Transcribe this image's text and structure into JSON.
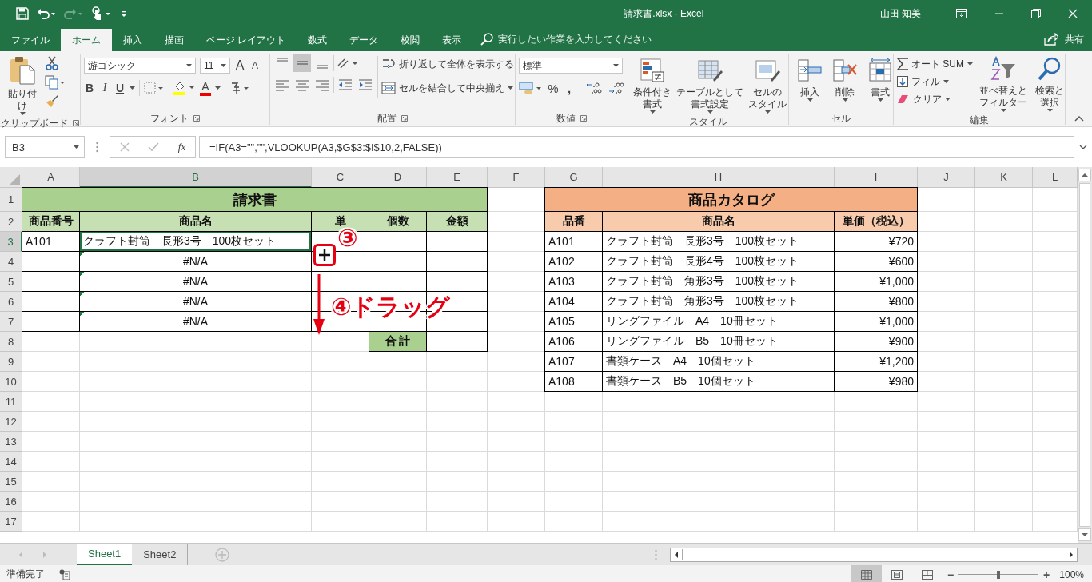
{
  "title_bar": {
    "title": "請求書.xlsx  -  Excel",
    "user": "山田 知美"
  },
  "tabs": [
    {
      "label": "ファイル",
      "selected": false
    },
    {
      "label": "ホーム",
      "selected": true
    },
    {
      "label": "挿入",
      "selected": false
    },
    {
      "label": "描画",
      "selected": false
    },
    {
      "label": "ページ レイアウト",
      "selected": false
    },
    {
      "label": "数式",
      "selected": false
    },
    {
      "label": "データ",
      "selected": false
    },
    {
      "label": "校閲",
      "selected": false
    },
    {
      "label": "表示",
      "selected": false
    }
  ],
  "tell_me": {
    "placeholder": "実行したい作業を入力してください"
  },
  "share": "共有",
  "ribbon": {
    "clipboard": {
      "paste": "貼り付け",
      "label": "クリップボード"
    },
    "font": {
      "name": "游ゴシック",
      "size": "11",
      "grow": "A",
      "shrink": "A",
      "bold": "B",
      "italic": "I",
      "underline": "U",
      "font_color": "A",
      "label": "フォント"
    },
    "alignment": {
      "wrap": "折り返して全体を表示する",
      "merge": "セルを結合して中央揃え",
      "label": "配置"
    },
    "number": {
      "format": "標準",
      "percent": "%",
      "comma": ",",
      "label": "数値"
    },
    "styles": {
      "buttons": [
        {
          "lines": [
            "条件付き",
            "書式"
          ]
        },
        {
          "lines": [
            "テーブルとして",
            "書式設定"
          ]
        },
        {
          "lines": [
            "セルの",
            "スタイル"
          ]
        }
      ],
      "label": "スタイル"
    },
    "cells": {
      "buttons": [
        {
          "lines": [
            "挿入"
          ]
        },
        {
          "lines": [
            "削除"
          ]
        },
        {
          "lines": [
            "書式"
          ]
        }
      ],
      "label": "セル"
    },
    "editing": {
      "autosum": "オート SUM",
      "fill": "フィル",
      "clear": "クリア",
      "sort": [
        "並べ替えと",
        "フィルター"
      ],
      "find": [
        "検索と",
        "選択"
      ],
      "label": "編集"
    }
  },
  "formula_bar": {
    "name_box": "B3",
    "fx": "fx",
    "formula": "=IF(A3=\"\",\"\",VLOOKUP(A3,$G$3:$I$10,2,FALSE))"
  },
  "sheet": {
    "columns": [
      {
        "label": "A",
        "selected": false
      },
      {
        "label": "B",
        "selected": true
      },
      {
        "label": "C",
        "selected": false
      },
      {
        "label": "D",
        "selected": false
      },
      {
        "label": "E",
        "selected": false
      },
      {
        "label": "F",
        "selected": false
      },
      {
        "label": "G",
        "selected": false
      },
      {
        "label": "H",
        "selected": false
      },
      {
        "label": "I",
        "selected": false
      },
      {
        "label": "J",
        "selected": false
      },
      {
        "label": "K",
        "selected": false
      },
      {
        "label": "L",
        "selected": false
      }
    ],
    "rows": [
      {
        "label": "1",
        "selected": false
      },
      {
        "label": "2",
        "selected": false
      },
      {
        "label": "3",
        "selected": true
      },
      {
        "label": "4",
        "selected": false
      },
      {
        "label": "5",
        "selected": false
      },
      {
        "label": "6",
        "selected": false
      },
      {
        "label": "7",
        "selected": false
      },
      {
        "label": "8",
        "selected": false
      },
      {
        "label": "9",
        "selected": false
      },
      {
        "label": "10",
        "selected": false
      },
      {
        "label": "11",
        "selected": false
      },
      {
        "label": "12",
        "selected": false
      },
      {
        "label": "13",
        "selected": false
      },
      {
        "label": "14",
        "selected": false
      },
      {
        "label": "15",
        "selected": false
      },
      {
        "label": "16",
        "selected": false
      },
      {
        "label": "17",
        "selected": false
      }
    ],
    "invoice": {
      "title": "請求書",
      "headers": [
        "商品番号",
        "商品名",
        "単",
        "個数",
        "金額"
      ],
      "rows": [
        {
          "code": {
            "text": "A101",
            "selected": false
          },
          "name": {
            "text": "クラフト封筒　長形3号　100枚セット",
            "kind": "value",
            "selected": true
          }
        },
        {
          "name": {
            "text": "#N/A",
            "kind": "error",
            "selected": false
          }
        },
        {
          "name": {
            "text": "#N/A",
            "kind": "error",
            "selected": false
          }
        },
        {
          "name": {
            "text": "#N/A",
            "kind": "error",
            "selected": false
          }
        },
        {
          "name": {
            "text": "#N/A",
            "kind": "error",
            "selected": false
          }
        }
      ],
      "total_label": "合 計"
    },
    "catalog": {
      "title": "商品カタログ",
      "headers": [
        "品番",
        "商品名",
        "単価（税込）"
      ],
      "rows": [
        {
          "code": "A101",
          "name": "クラフト封筒　長形3号　100枚セット",
          "price": "¥720"
        },
        {
          "code": "A102",
          "name": "クラフト封筒　長形4号　100枚セット",
          "price": "¥600"
        },
        {
          "code": "A103",
          "name": "クラフト封筒　角形3号　100枚セット",
          "price": "¥1,000"
        },
        {
          "code": "A104",
          "name": "クラフト封筒　角形3号　100枚セット",
          "price": "¥800"
        },
        {
          "code": "A105",
          "name": "リングファイル　A4　10冊セット",
          "price": "¥1,000"
        },
        {
          "code": "A106",
          "name": "リングファイル　B5　10冊セット",
          "price": "¥900"
        },
        {
          "code": "A107",
          "name": "書類ケース　A4　10個セット",
          "price": "¥1,200"
        },
        {
          "code": "A108",
          "name": "書類ケース　B5　10個セット",
          "price": "¥980"
        }
      ]
    }
  },
  "annotations": [
    {
      "kind": "step",
      "text": "③"
    },
    {
      "kind": "step",
      "text": "④ドラッグ"
    },
    {
      "kind": "arrow"
    },
    {
      "kind": "handle"
    }
  ],
  "sheet_tabs": [
    {
      "label": "Sheet1",
      "selected": true
    },
    {
      "label": "Sheet2",
      "selected": false
    }
  ],
  "status_bar": {
    "status": "準備完了",
    "views": [
      {
        "selected": true
      },
      {
        "selected": false
      },
      {
        "selected": false
      }
    ],
    "zoom_out": "−",
    "zoom_in": "+",
    "zoom": {
      "level": 0.5
    },
    "zoom_label": "100%"
  }
}
